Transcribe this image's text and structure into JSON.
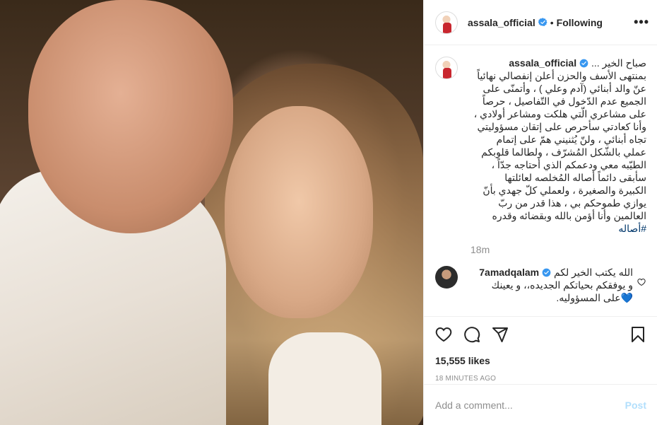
{
  "post": {
    "username": "assala_official",
    "separator": "•",
    "follow_status": "Following",
    "more_icon": "•••",
    "caption": {
      "lines": [
        "... صباح الخير",
        "بمنتهى الأسف والحزن أعلن إنفصالي نهائياً",
        "عنّ والد أبنائي (آدم وعلي ) ، وأتمنّى على",
        "الجميع عدم الدّخول في التّفاصيل ، حرصاً",
        "على مشاعري الّتي هلكت ومشاعر أولادي ،",
        "وأنا كعادتي سأحرص على إتقان مسؤوليتي",
        "تجاه أبنائي ، ولنّ يُثنيني همّ على إتمام",
        "عملي بالشّكل المُشرّف ، ولطالما قلوبكم",
        "الطيّبه معي ودعمكم الذي أحتاجه جدّاً ،",
        "سأبقى دائماً أصاله المُخلصه لعائلتها",
        "الكبيرة والصغيرة ، ولعملي كلّ جهدي بأنّ",
        "يوازي طموحكم بي ، هذا قدر من ربّ",
        "العالمين وأنا أؤمن بالله وبقضائه وقدره"
      ],
      "hashtag": "#أصاله",
      "time": "18m"
    },
    "comment": {
      "username": "7amadqalam",
      "lines": [
        "الله يكتب الخير لكم",
        "و يوفقكم بحياتكم الجديده،، و يعينك",
        "على المسؤوليه."
      ],
      "heart_emoji": "💙"
    },
    "likes": "15,555 likes",
    "time_ago": "18 MINUTES AGO",
    "add_comment": {
      "placeholder": "Add a comment...",
      "post_label": "Post"
    }
  },
  "colors": {
    "verified": "#3897f0",
    "post_disabled": "#b2dffc",
    "hashtag": "#00376b",
    "muted": "#8e8e8e"
  },
  "icons": {
    "like": "heart-icon",
    "comment": "comment-bubble-icon",
    "share": "paper-plane-icon",
    "save": "bookmark-icon",
    "options": "more-options-icon",
    "verified": "verified-badge-icon",
    "comment_like": "small-heart-icon"
  }
}
